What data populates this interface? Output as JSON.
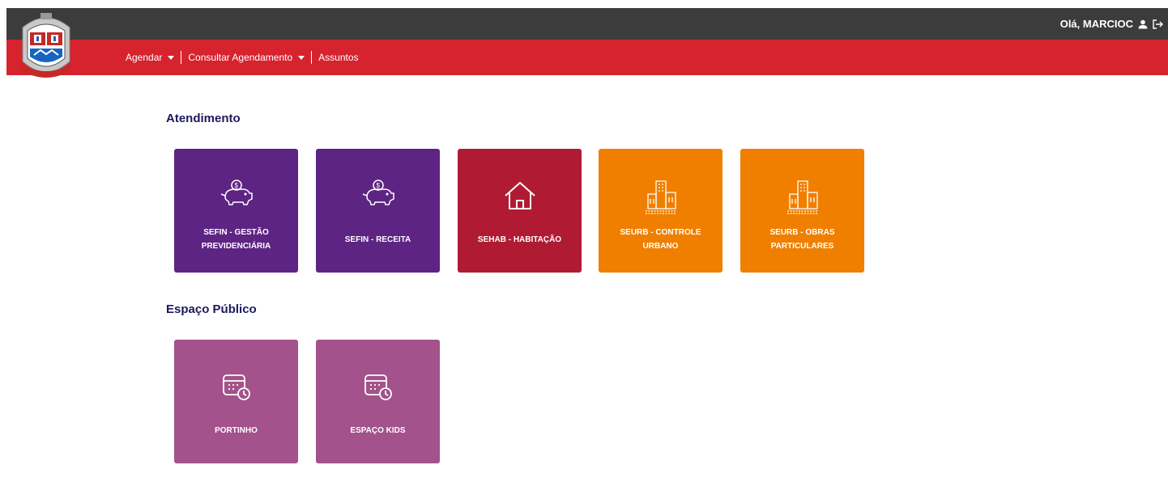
{
  "header": {
    "greeting": "Olá, MARCIOC",
    "user_icon": "user-icon",
    "logout_icon": "logout-icon",
    "logo_icon": "city-crest-logo"
  },
  "nav": {
    "items": [
      {
        "label": "Agendar",
        "dropdown": true
      },
      {
        "label": "Consultar Agendamento",
        "dropdown": true
      },
      {
        "label": "Assuntos",
        "dropdown": false
      }
    ]
  },
  "sections": [
    {
      "title": "Atendimento",
      "tiles": [
        {
          "label": "SEFIN - GESTÃO\nPREVIDENCIÁRIA",
          "icon": "piggy-bank-icon",
          "color": "#5e2483"
        },
        {
          "label": "SEFIN - RECEITA",
          "icon": "piggy-bank-icon",
          "color": "#5e2483"
        },
        {
          "label": "SEHAB - HABITAÇÃO",
          "icon": "house-icon",
          "color": "#b01b33"
        },
        {
          "label": "SEURB - CONTROLE\nURBANO",
          "icon": "buildings-icon",
          "color": "#f07f00"
        },
        {
          "label": "SEURB - OBRAS\nPARTICULARES",
          "icon": "buildings-icon",
          "color": "#f07f00"
        }
      ]
    },
    {
      "title": "Espaço Público",
      "tiles": [
        {
          "label": "PORTINHO",
          "icon": "calendar-clock-icon",
          "color": "#a3528b"
        },
        {
          "label": "ESPAÇO KIDS",
          "icon": "calendar-clock-icon",
          "color": "#a3528b"
        }
      ]
    }
  ],
  "colors": {
    "topbar": "#3c3c3c",
    "navbar": "#d6232e",
    "heading": "#1e1a5e"
  }
}
